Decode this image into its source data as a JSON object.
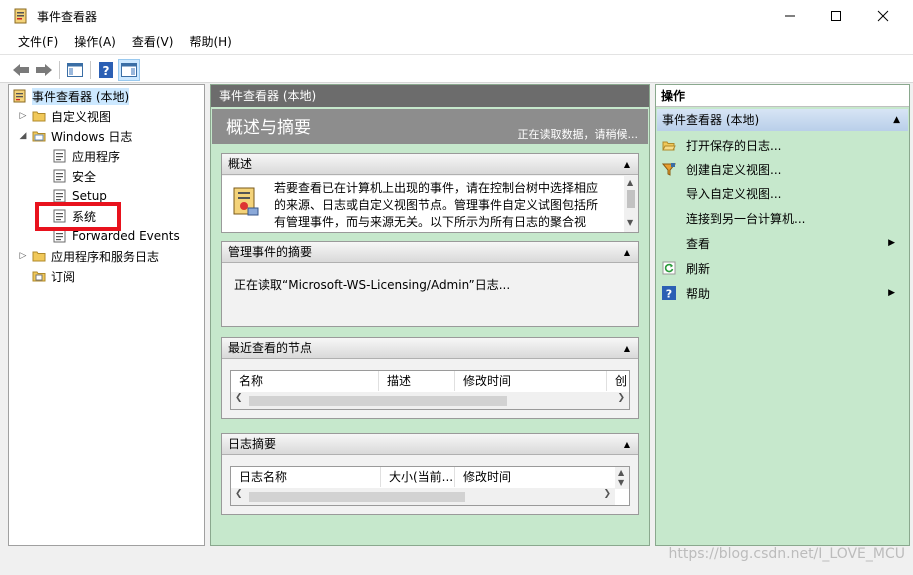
{
  "window": {
    "title": "事件查看器"
  },
  "menu": [
    "文件(F)",
    "操作(A)",
    "查看(V)",
    "帮助(H)"
  ],
  "tree": {
    "root": "事件查看器 (本地)",
    "custom_views": "自定义视图",
    "windows_logs": "Windows 日志",
    "windows_logs_children": [
      "应用程序",
      "安全",
      "Setup",
      "系统",
      "Forwarded Events"
    ],
    "app_service_logs": "应用程序和服务日志",
    "subscriptions": "订阅"
  },
  "center": {
    "header": "事件查看器 (本地)",
    "title": "概述与摘要",
    "status": "正在读取数据，请稍候...",
    "overview": {
      "heading": "概述",
      "text_lines": [
        "若要查看已在计算机上出现的事件，请在控制台树中选择相应",
        "的来源、日志或自定义视图节点。管理事件自定义试图包括所",
        "有管理事件，而与来源无关。以下所示为所有日志的聚合视"
      ]
    },
    "admin_summary": {
      "heading": "管理事件的摘要",
      "text": "正在读取“Microsoft-WS-Licensing/Admin”日志..."
    },
    "recent_nodes": {
      "heading": "最近查看的节点",
      "columns": [
        "名称",
        "描述",
        "修改时间",
        "创"
      ]
    },
    "log_summary": {
      "heading": "日志摘要",
      "columns": [
        "日志名称",
        "大小(当前...",
        "修改时间"
      ]
    }
  },
  "actions": {
    "header": "操作",
    "group": "事件查看器 (本地)",
    "items": [
      {
        "label": "打开保存的日志...",
        "icon": "folder-open-icon"
      },
      {
        "label": "创建自定义视图...",
        "icon": "filter-icon"
      },
      {
        "label": "导入自定义视图...",
        "icon": ""
      },
      {
        "label": "连接到另一台计算机...",
        "icon": ""
      },
      {
        "label": "查看",
        "icon": "",
        "submenu": true
      },
      {
        "label": "刷新",
        "icon": "refresh-icon"
      },
      {
        "label": "帮助",
        "icon": "help-icon",
        "submenu": true
      }
    ]
  },
  "watermark": "https://blog.csdn.net/I_LOVE_MCU",
  "colors": {
    "pane_bg": "#c6e8cc",
    "selection": "#cce8ff",
    "highlight_box": "#e8121d"
  }
}
